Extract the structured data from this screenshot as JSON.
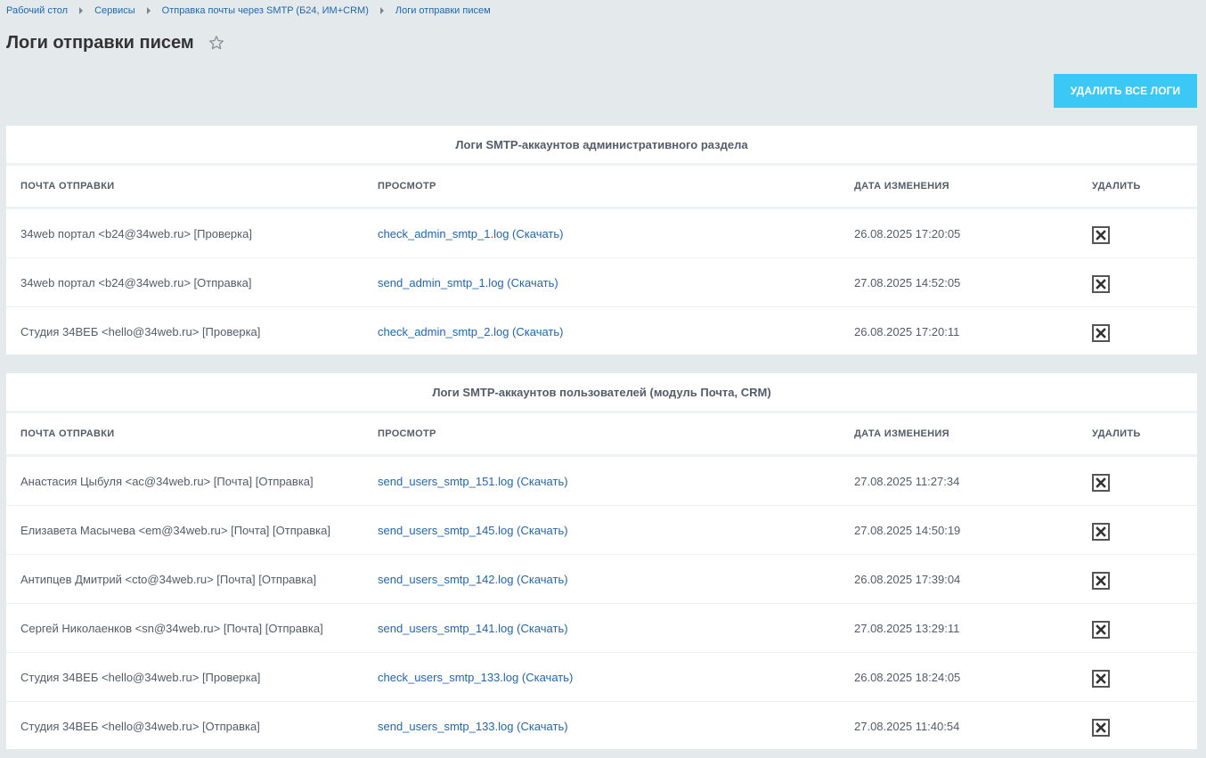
{
  "breadcrumbs": [
    "Рабочий стол",
    "Сервисы",
    "Отправка почты через SMTP (Б24, ИМ+CRM)",
    "Логи отправки писем"
  ],
  "page_title": "Логи отправки писем",
  "delete_all_label": "УДАЛИТЬ ВСЕ ЛОГИ",
  "columns": [
    "ПОЧТА ОТПРАВКИ",
    "ПРОСМОТР",
    "ДАТА ИЗМЕНЕНИЯ",
    "УДАЛИТЬ"
  ],
  "download_label": "Скачать",
  "sections": [
    {
      "title": "Логи SMTP-аккаунтов административного раздела",
      "rows": [
        {
          "sender": "34web портал <b24@34web.ru> [Проверка]",
          "file": "check_admin_smtp_1.log",
          "date": "26.08.2025 17:20:05"
        },
        {
          "sender": "34web портал <b24@34web.ru> [Отправка]",
          "file": "send_admin_smtp_1.log",
          "date": "27.08.2025 14:52:05"
        },
        {
          "sender": "Студия 34ВЕБ <hello@34web.ru> [Проверка]",
          "file": "check_admin_smtp_2.log",
          "date": "26.08.2025 17:20:11"
        }
      ]
    },
    {
      "title": "Логи SMTP-аккаунтов пользователей (модуль Почта, CRM)",
      "rows": [
        {
          "sender": "Анастасия Цыбуля <ac@34web.ru> [Почта] [Отправка]",
          "file": "send_users_smtp_151.log",
          "date": "27.08.2025 11:27:34"
        },
        {
          "sender": "Елизавета Масычева <em@34web.ru> [Почта] [Отправка]",
          "file": "send_users_smtp_145.log",
          "date": "27.08.2025 14:50:19"
        },
        {
          "sender": "Антипцев Дмитрий <cto@34web.ru> [Почта] [Отправка]",
          "file": "send_users_smtp_142.log",
          "date": "26.08.2025 17:39:04"
        },
        {
          "sender": "Сергей Николаенков <sn@34web.ru> [Почта] [Отправка]",
          "file": "send_users_smtp_141.log",
          "date": "27.08.2025 13:29:11"
        },
        {
          "sender": "Студия 34ВЕБ <hello@34web.ru> [Проверка]",
          "file": "check_users_smtp_133.log",
          "date": "26.08.2025 18:24:05"
        },
        {
          "sender": "Студия 34ВЕБ <hello@34web.ru> [Отправка]",
          "file": "send_users_smtp_133.log",
          "date": "27.08.2025 11:40:54"
        }
      ]
    }
  ],
  "colors": {
    "background": "#e4eaeb",
    "accent_button": "#3bc8f5",
    "link": "#2067b0",
    "text": "#535c69"
  },
  "icons": {
    "favorite": "star-outline-icon",
    "delete": "close-box-icon",
    "separator": "triangle-right-icon"
  }
}
